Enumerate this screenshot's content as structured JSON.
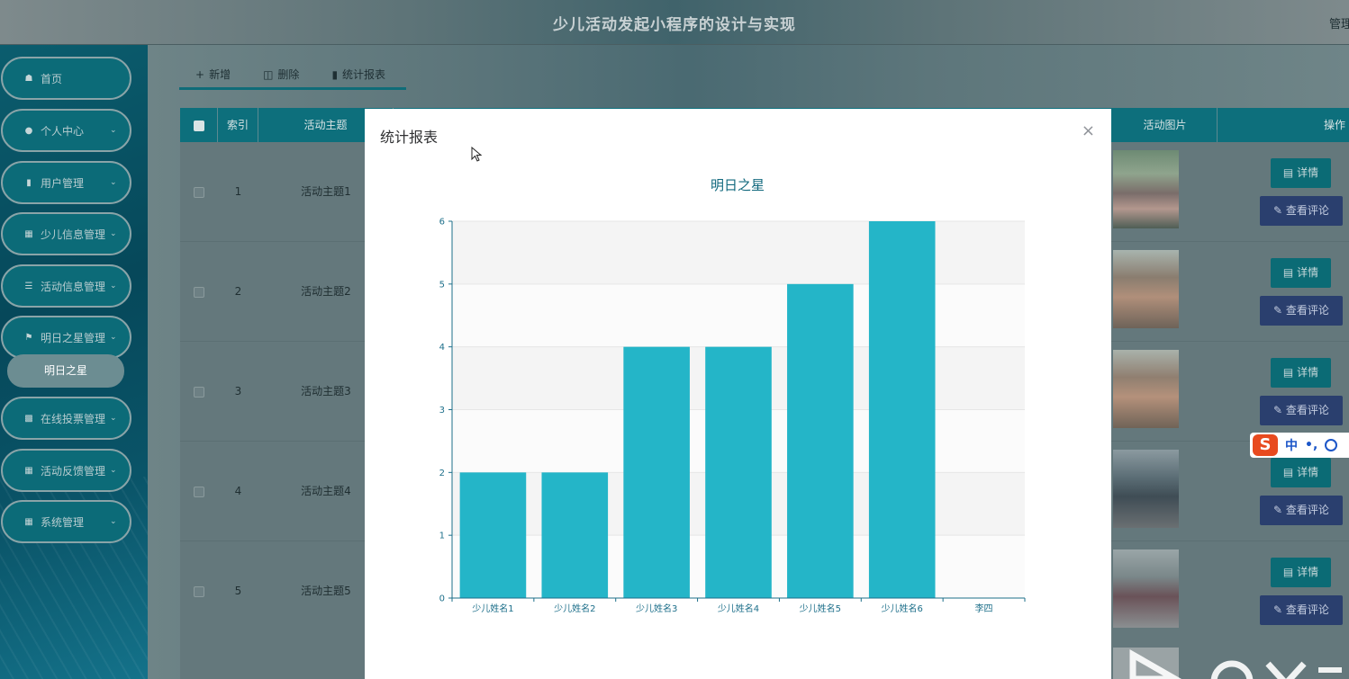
{
  "header": {
    "title": "少儿活动发起小程序的设计与实现",
    "admin": "管理"
  },
  "sidebar": {
    "items": [
      {
        "label": "首页",
        "icon": "home-icon",
        "expandable": false
      },
      {
        "label": "个人中心",
        "icon": "user-icon",
        "expandable": true
      },
      {
        "label": "用户管理",
        "icon": "chat-icon",
        "expandable": true
      },
      {
        "label": "少儿信息管理",
        "icon": "grid-icon",
        "expandable": true
      },
      {
        "label": "活动信息管理",
        "icon": "list-icon",
        "expandable": true
      },
      {
        "label": "明日之星管理",
        "icon": "flag-icon",
        "expandable": true
      },
      {
        "label": "在线投票管理",
        "icon": "briefcase-icon",
        "expandable": true
      },
      {
        "label": "活动反馈管理",
        "icon": "grid-icon",
        "expandable": true
      },
      {
        "label": "系统管理",
        "icon": "grid-icon",
        "expandable": true
      }
    ],
    "sub_item": "明日之星"
  },
  "toolbar": {
    "add": "新增",
    "delete": "删除",
    "report": "统计报表"
  },
  "table": {
    "headers": {
      "index": "索引",
      "topic": "活动主题",
      "picture": "活动图片",
      "action": "操作"
    },
    "rows": [
      {
        "index": "1",
        "topic": "活动主题1"
      },
      {
        "index": "2",
        "topic": "活动主题2"
      },
      {
        "index": "3",
        "topic": "活动主题3"
      },
      {
        "index": "4",
        "topic": "活动主题4"
      },
      {
        "index": "5",
        "topic": "活动主题5"
      }
    ],
    "detail_label": "详情",
    "comment_label": "查看评论"
  },
  "ime": {
    "logo": "S",
    "mode": "中",
    "punct": "•,"
  },
  "modal": {
    "title": "统计报表",
    "close": "×"
  },
  "chart_data": {
    "type": "bar",
    "title": "明日之星",
    "categories": [
      "少儿姓名1",
      "少儿姓名2",
      "少儿姓名3",
      "少儿姓名4",
      "少儿姓名5",
      "少儿姓名6",
      "李四"
    ],
    "values": [
      2,
      2,
      4,
      4,
      5,
      6,
      0
    ],
    "ylim": [
      0,
      6
    ],
    "yticks": [
      0,
      1,
      2,
      3,
      4,
      5,
      6
    ],
    "xlabel": "",
    "ylabel": "",
    "grid": true,
    "bar_color": "#24b5c8",
    "title_color": "#12697e",
    "axis_color": "#1d6f8a"
  },
  "colors": {
    "accent": "#0d6f7c",
    "sidebar": "#0b5d6e",
    "detail_button": "#0b6b75",
    "comment_button": "#2a3f6e"
  }
}
